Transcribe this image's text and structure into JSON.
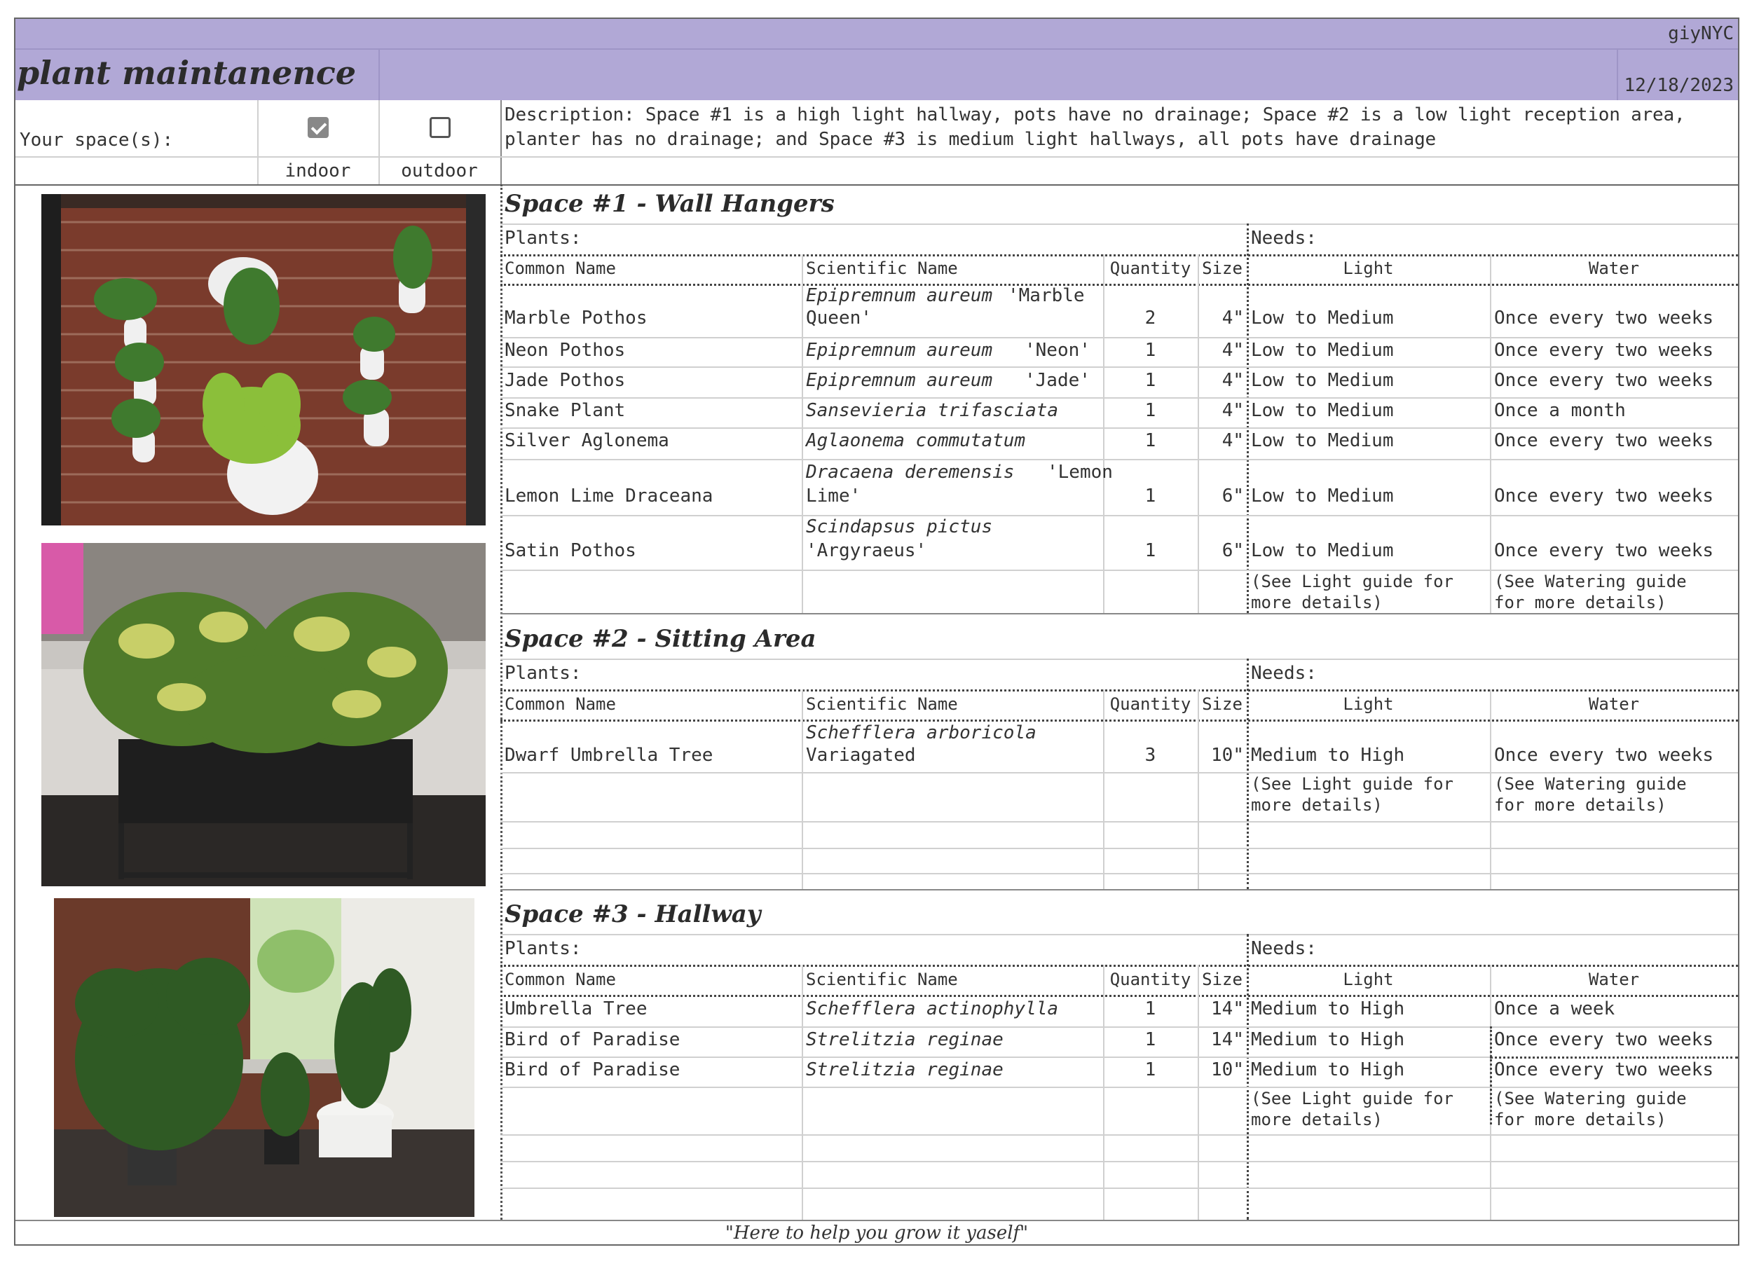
{
  "brand": "giyNYC",
  "title": "plant maintanence",
  "date": "12/18/2023",
  "space_label": "Your space(s):",
  "options": [
    {
      "label": "indoor",
      "checked": true
    },
    {
      "label": "outdoor",
      "checked": false
    }
  ],
  "description": "Description: Space #1 is a high light hallway, pots have no drainage; Space #2 is a low light reception area, planter has no drainage; and Space #3 is medium light hallways, all pots have drainage",
  "labels": {
    "plants": "Plants:",
    "needs": "Needs:",
    "common": "Common Name",
    "scientific": "Scientific Name",
    "quantity": "Quantity",
    "size": "Size",
    "light": "Light",
    "water": "Water",
    "light_note": "(See Light guide for more details)",
    "water_note": "(See Watering guide for more details)"
  },
  "sections": [
    {
      "title": "Space #1 - Wall Hangers",
      "rows": [
        {
          "common": "Marble Pothos",
          "sci_italic": "Epipremnum aureum",
          "sci_extra": "'Marble Queen'",
          "qty": "2",
          "size": "4\"",
          "light": "Low to Medium",
          "water": "Once every two weeks"
        },
        {
          "common": "Neon Pothos",
          "sci_italic": "Epipremnum aureum",
          "sci_extra": "'Neon'",
          "qty": "1",
          "size": "4\"",
          "light": "Low to Medium",
          "water": "Once every two weeks"
        },
        {
          "common": "Jade Pothos",
          "sci_italic": "Epipremnum aureum",
          "sci_extra": "'Jade'",
          "qty": "1",
          "size": "4\"",
          "light": "Low to Medium",
          "water": "Once every two weeks"
        },
        {
          "common": "Snake Plant",
          "sci_italic": "Sansevieria trifasciata",
          "sci_extra": "",
          "qty": "1",
          "size": "4\"",
          "light": "Low to Medium",
          "water": "Once a month"
        },
        {
          "common": "Silver Aglonema",
          "sci_italic": "Aglaonema commutatum",
          "sci_extra": "",
          "qty": "1",
          "size": "4\"",
          "light": "Low to Medium",
          "water": "Once every two weeks"
        },
        {
          "common": "Lemon Lime Draceana",
          "sci_italic": "Dracaena deremensis",
          "sci_extra": "'Lemon Lime'",
          "qty": "1",
          "size": "6\"",
          "light": "Low to Medium",
          "water": "Once every two weeks"
        },
        {
          "common": "Satin Pothos",
          "sci_italic": "Scindapsus pictus",
          "sci_extra": "'Argyraeus'",
          "qty": "1",
          "size": "6\"",
          "light": "Low to Medium",
          "water": "Once every two weeks"
        }
      ]
    },
    {
      "title": "Space #2 - Sitting Area",
      "rows": [
        {
          "common": "Dwarf Umbrella Tree",
          "sci_italic": "Schefflera arboricola",
          "sci_extra": "Variagated",
          "qty": "3",
          "size": "10\"",
          "light": "Medium to High",
          "water": "Once every two weeks"
        }
      ]
    },
    {
      "title": "Space #3 - Hallway",
      "rows": [
        {
          "common": "Umbrella Tree",
          "sci_italic": "Schefflera actinophylla",
          "sci_extra": "",
          "qty": "1",
          "size": "14\"",
          "light": "Medium to High",
          "water": "Once a week"
        },
        {
          "common": "Bird of Paradise",
          "sci_italic": "Strelitzia reginae",
          "sci_extra": "",
          "qty": "1",
          "size": "14\"",
          "light": "Medium to High",
          "water": "Once every two weeks"
        },
        {
          "common": "Bird of Paradise",
          "sci_italic": "Strelitzia reginae",
          "sci_extra": "",
          "qty": "1",
          "size": "10\"",
          "light": "Medium to High",
          "water": "Once every two weeks"
        }
      ]
    }
  ],
  "tagline": "\"Here to help you grow it yaself\"",
  "colors": {
    "header": "#b1a8d6"
  }
}
